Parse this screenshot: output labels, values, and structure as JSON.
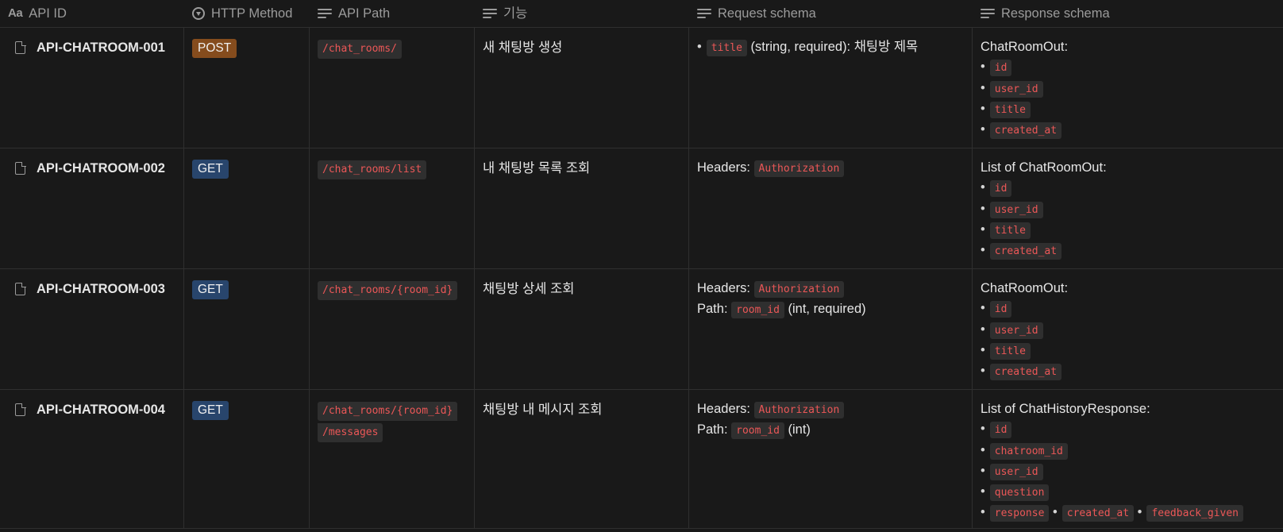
{
  "headers": {
    "api_id": "API ID",
    "method": "HTTP Method",
    "path": "API Path",
    "feature": "기능",
    "request": "Request schema",
    "response": "Response schema"
  },
  "rows": [
    {
      "id": "API-CHATROOM-001",
      "method": "POST",
      "path": [
        "/chat_rooms/"
      ],
      "feature": "새 채팅방 생성",
      "req_title_code": "title",
      "req_title_desc": "(string, required): 채팅방 제목",
      "resp_title": "ChatRoomOut:",
      "resp_fields": [
        "id",
        "user_id",
        "title",
        "created_at"
      ]
    },
    {
      "id": "API-CHATROOM-002",
      "method": "GET",
      "path": [
        "/chat_rooms/list"
      ],
      "feature": "내 채팅방 목록 조회",
      "req_headers_label": "Headers:",
      "req_headers_code": "Authorization",
      "resp_title": "List of ChatRoomOut:",
      "resp_fields": [
        "id",
        "user_id",
        "title",
        "created_at"
      ]
    },
    {
      "id": "API-CHATROOM-003",
      "method": "GET",
      "path": [
        "/chat_rooms/{room_id}"
      ],
      "feature": "채팅방 상세 조회",
      "req_headers_label": "Headers:",
      "req_headers_code": "Authorization",
      "req_path_label": "Path:",
      "req_path_code": "room_id",
      "req_path_desc": "(int, required)",
      "resp_title": "ChatRoomOut:",
      "resp_fields": [
        "id",
        "user_id",
        "title",
        "created_at"
      ]
    },
    {
      "id": "API-CHATROOM-004",
      "method": "GET",
      "path": [
        "/chat_rooms/{room_id}",
        "/messages"
      ],
      "feature": "채팅방 내 메시지 조회",
      "req_headers_label": "Headers:",
      "req_headers_code": "Authorization",
      "req_path_label": "Path:",
      "req_path_code": "room_id",
      "req_path_desc": "(int)",
      "resp_title": "List of ChatHistoryResponse:",
      "resp_fields": [
        "id",
        "chatroom_id",
        "user_id",
        "question"
      ],
      "resp_last_line": [
        "response",
        "created_at",
        "feedback_given"
      ]
    }
  ],
  "colors": {
    "background": "#191919",
    "post_badge": "#854c1d",
    "get_badge": "#28456c",
    "code_text": "#eb5757",
    "code_bg": "#2f2f2f"
  }
}
